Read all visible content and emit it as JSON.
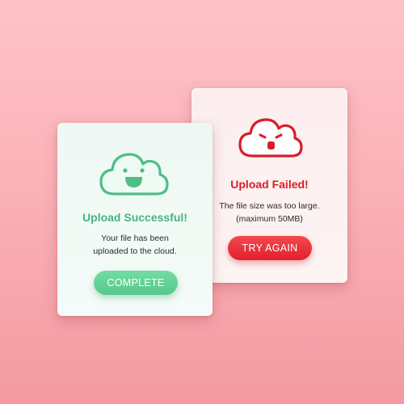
{
  "colors": {
    "error": "#d81f2a",
    "success": "#46b583",
    "retry_button": "#e8333b",
    "complete_button": "#62d296",
    "background": "#fbb2b8"
  },
  "failed_card": {
    "icon": "sad-cloud-icon",
    "title": "Upload Failed!",
    "message_line1": "The file size was too large.",
    "message_line2": "(maximum 50MB)",
    "button_label": "TRY AGAIN"
  },
  "success_card": {
    "icon": "happy-cloud-icon",
    "title": "Upload Successful!",
    "message_line1": "Your file has been",
    "message_line2": "uploaded to the cloud.",
    "button_label": "COMPLETE"
  }
}
